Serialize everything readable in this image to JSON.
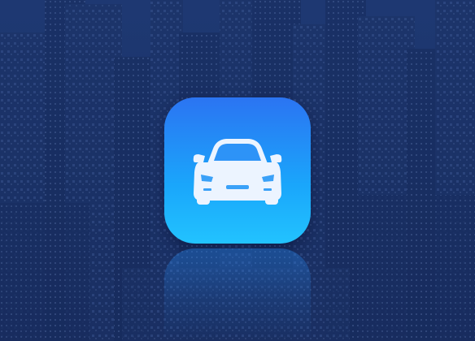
{
  "scene": {
    "background_icon": "city-skyline-background",
    "tint_color": "#1c3a7a"
  },
  "app_icon": {
    "icon": "car-icon",
    "gradient_top": "#2b74f2",
    "gradient_bottom": "#22c3fe",
    "glyph_color": "#ecf4ff"
  }
}
